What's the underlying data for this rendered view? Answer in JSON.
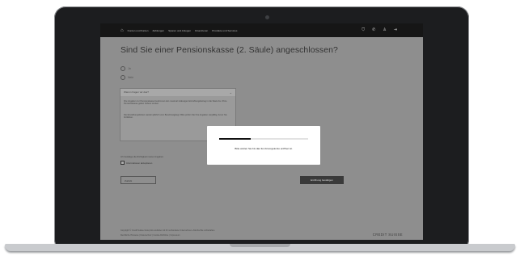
{
  "nav": {
    "logo_icon": "home-icon",
    "items": [
      "Konten und Karten",
      "Zahlungen",
      "Sparen und Anlegen",
      "Finanzieren",
      "Produkte und Services"
    ],
    "icons": [
      "shield-icon",
      "phone-icon",
      "user-icon",
      "logout-icon"
    ]
  },
  "main": {
    "question": "Sind Sie einer Pensionskasse (2. Säule) angeschlossen?",
    "option_yes": "Ja",
    "option_no": "Nein"
  },
  "info": {
    "heading": "Warum fragen wir das?",
    "paragraph1": "Ihre Angaben zur Pensionskasse bestimmen den maximal zulässigen Einzahlungsbetrag in die Säule 3a. Ohne Pensionskasse gelten höhere Limiten.",
    "paragraph2": "Die Einzahlungslimiten werden jährlich vom Bund festgelegt. Bitte prüfen Sie Ihre Angaben sorgfältig, bevor Sie fortfahren."
  },
  "form": {
    "footnote": "Ich bestätige die Richtigkeit meiner Angaben.",
    "checkbox_label": "Informationen akzeptieren",
    "back_label": "Zurück",
    "confirm_label": "Eröffnung bestätigen"
  },
  "modal": {
    "progress": 0.35,
    "message": "Bitte warten Sie bis das 3a Vorsorgekonto eröffnet ist."
  },
  "footer": {
    "line1": "Copyright © Credit Suisse Group AG und/oder mit ihr verbundene Unternehmen. Alle Rechte vorbehalten.",
    "line2": "Rechtliche Hinweise  |  Datenschutz  |  Cookie-Richtlinie  |  Impressum",
    "logo_text": "CREDIT SUISSE"
  }
}
